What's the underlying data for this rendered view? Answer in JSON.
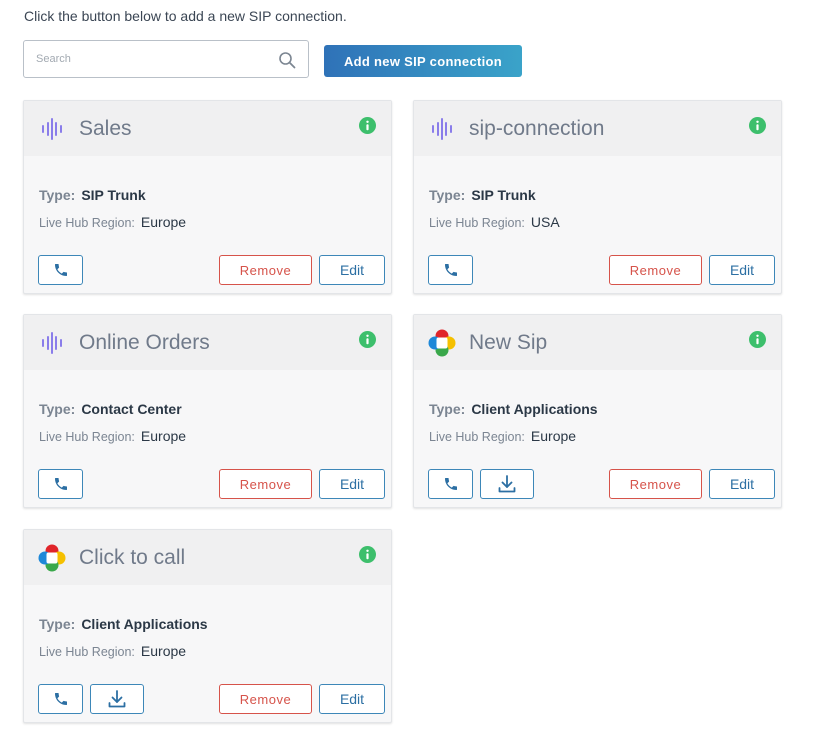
{
  "intro_text": "Click the button below to add a new SIP connection.",
  "search": {
    "placeholder": "Search",
    "value": ""
  },
  "add_button_label": "Add new SIP connection",
  "labels": {
    "type": "Type:",
    "region": "Live Hub Region:",
    "remove": "Remove",
    "edit": "Edit"
  },
  "colors": {
    "accent": "#2f72b8",
    "remove": "#d6534a",
    "info": "#3dbf6c",
    "sip_icon": "#8a7dea"
  },
  "cards": [
    {
      "title": "Sales",
      "type": "SIP Trunk",
      "region": "Europe",
      "icon": "sip-waveform-icon",
      "has_download": false
    },
    {
      "title": "sip-connection",
      "type": "SIP Trunk",
      "region": "USA",
      "icon": "sip-waveform-icon",
      "has_download": false
    },
    {
      "title": "Online Orders",
      "type": "Contact Center",
      "region": "Europe",
      "icon": "sip-waveform-icon",
      "has_download": false
    },
    {
      "title": "New Sip",
      "type": "Client Applications",
      "region": "Europe",
      "icon": "webrtc-logo-icon",
      "has_download": true
    },
    {
      "title": "Click to call",
      "type": "Client Applications",
      "region": "Europe",
      "icon": "webrtc-logo-icon",
      "has_download": true
    }
  ]
}
